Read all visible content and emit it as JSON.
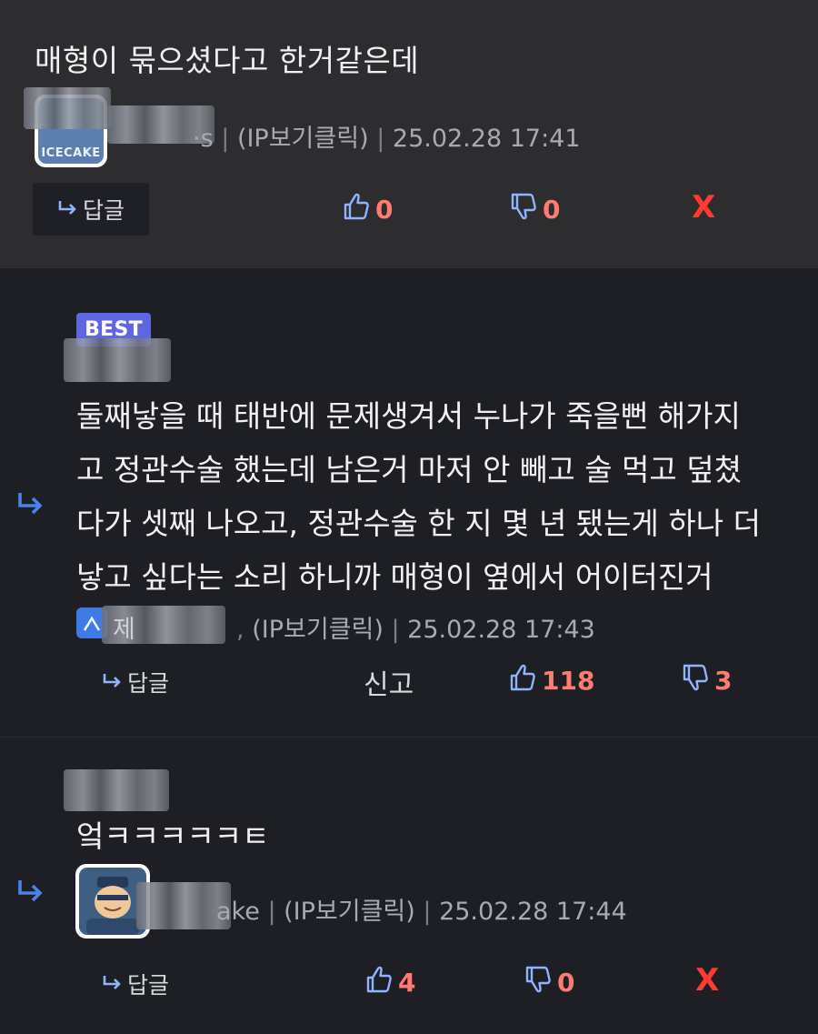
{
  "comments": [
    {
      "text": "매형이 묶으셨다고 한거같은데",
      "avatar_label": "ICECAKE",
      "author_tail": "·s",
      "ip_label": "(IP보기클릭)",
      "timestamp": "25.02.28 17:41",
      "reply_label": "답글",
      "likes": "0",
      "dislikes": "0",
      "delete_label": "X"
    },
    {
      "badge": "BEST",
      "lines": [
        "둘째낳을 때 태반에 문제생겨서 누나가 죽을뻔 해가지",
        "고 정관수술 했는데 남은거 마저 안 빼고 술 먹고 덮쳤",
        "다가 셋째 나오고, 정관수술 한 지 몇 년 됐는게 하나 더",
        "낳고 싶다는 소리 하니까 매형이 옆에서 어이터진거"
      ],
      "author_prefix": "제 ",
      "ip_label": "(IP보기클릭)",
      "timestamp": "25.02.28 17:43",
      "reply_label": "답글",
      "report_label": "신고",
      "likes": "118",
      "dislikes": "3"
    },
    {
      "text": "엌ㅋㅋㅋㅋㅋㅌ",
      "author_tail": "ake",
      "ip_label": "(IP보기클릭)",
      "timestamp": "25.02.28 17:44",
      "reply_label": "답글",
      "likes": "4",
      "dislikes": "0",
      "delete_label": "X"
    }
  ],
  "colors": {
    "background": "#1e1f24",
    "highlight_background": "#2d2d2f",
    "best_badge": "#5f66e2",
    "vote_count": "#ff7b72",
    "delete": "#ff3b30",
    "icon_blue": "#8fb4ff",
    "reply_arrow": "#4a82ea"
  },
  "icons": {
    "reply": "reply-arrow-icon",
    "like": "thumbs-up-icon",
    "dislike": "thumbs-down-icon",
    "nested": "nested-reply-arrow-icon"
  }
}
